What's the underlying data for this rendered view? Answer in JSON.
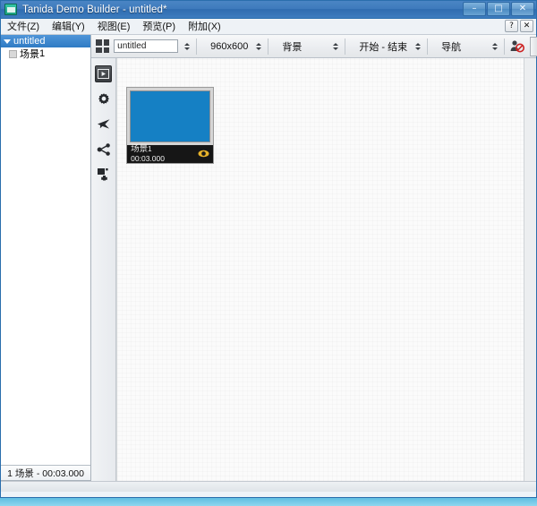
{
  "window": {
    "title": "Tanida Demo Builder - untitled*",
    "app_icon": "app-icon",
    "minimize_label": "–",
    "maximize_label": "□",
    "close_label": "✕"
  },
  "menubar": {
    "items": [
      {
        "label": "文件(Z)",
        "name": "menu-file"
      },
      {
        "label": "编辑(Y)",
        "name": "menu-edit"
      },
      {
        "label": "视图(E)",
        "name": "menu-view"
      },
      {
        "label": "预览(P)",
        "name": "menu-preview"
      },
      {
        "label": "附加(X)",
        "name": "menu-addons"
      }
    ],
    "help_label": "?",
    "mdi_close_label": "✕"
  },
  "tree": {
    "root_label": "untitled",
    "scene": {
      "label": "场景",
      "number": "1"
    }
  },
  "left_status": {
    "text": "1 场景 - 00:03.000"
  },
  "toolbar": {
    "grid_icon": "grid-view-icon",
    "project_name": "untitled",
    "project_name_placeholder": "untitled",
    "resolution": "960x600",
    "background": "背景",
    "start_end": "开始 - 结束",
    "navigation": "导航",
    "user_icon": "user-disabled-icon"
  },
  "vtoolbar": {
    "items": [
      {
        "name": "play-icon",
        "selected": true
      },
      {
        "name": "gear-icon",
        "selected": false
      },
      {
        "name": "plane-icon",
        "selected": false
      },
      {
        "name": "share-icon",
        "selected": false
      },
      {
        "name": "add-object-icon",
        "selected": false
      }
    ]
  },
  "scene_card": {
    "thumb_color": "#1580c4",
    "title": "场景",
    "number": "1",
    "duration": "00:03.000",
    "visibility_icon": "eye-icon"
  },
  "colors": {
    "titlebar_accent": "#3f7bbd",
    "tree_selection": "#2f7bc4",
    "scene_thumb": "#1580c4",
    "caption_bg": "#161616",
    "eye_gold": "#e8b32a"
  }
}
